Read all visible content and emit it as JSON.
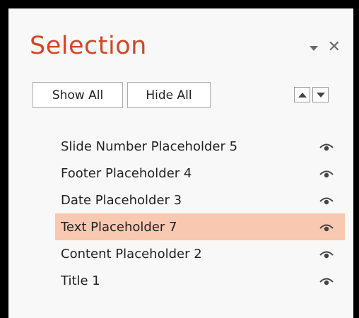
{
  "pane": {
    "title": "Selection",
    "show_all_label": "Show All",
    "hide_all_label": "Hide All",
    "icons": {
      "dropdown": "chevron-down-icon",
      "close": "close-icon",
      "bring_forward": "arrow-up-icon",
      "send_backward": "arrow-down-icon",
      "visibility": "eye-icon"
    },
    "colors": {
      "title": "#d24726",
      "selected_row": "#f8c8b0"
    }
  },
  "items": [
    {
      "label": "Slide Number Placeholder 5",
      "visible": true,
      "selected": false
    },
    {
      "label": "Footer Placeholder 4",
      "visible": true,
      "selected": false
    },
    {
      "label": "Date Placeholder 3",
      "visible": true,
      "selected": false
    },
    {
      "label": "Text Placeholder 7",
      "visible": true,
      "selected": true
    },
    {
      "label": "Content Placeholder 2",
      "visible": true,
      "selected": false
    },
    {
      "label": "Title 1",
      "visible": true,
      "selected": false
    }
  ]
}
